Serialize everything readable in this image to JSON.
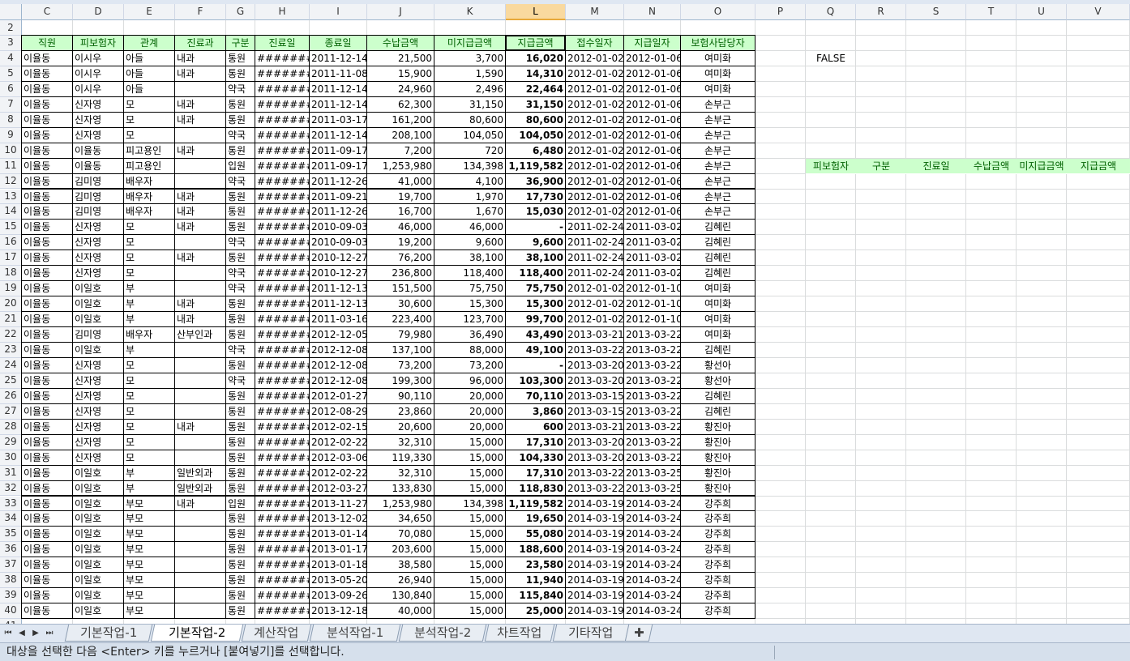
{
  "columns": [
    "C",
    "D",
    "E",
    "F",
    "G",
    "H",
    "I",
    "J",
    "K",
    "L",
    "M",
    "N",
    "O",
    "P",
    "Q",
    "R",
    "S",
    "T",
    "U",
    "V"
  ],
  "selected_column": "L",
  "row_numbers": [
    "2",
    "3",
    "4",
    "5",
    "6",
    "7",
    "8",
    "9",
    "10",
    "11",
    "12",
    "13",
    "14",
    "15",
    "16",
    "17",
    "18",
    "19",
    "20",
    "21",
    "22",
    "23",
    "24",
    "25",
    "26",
    "27",
    "28",
    "29",
    "30",
    "31",
    "32",
    "33",
    "34",
    "35",
    "36",
    "37",
    "38",
    "39",
    "40",
    "41"
  ],
  "table_headers": [
    "직원",
    "피보험자",
    "관계",
    "진료과",
    "구분",
    "진료일",
    "종료일",
    "수납금액",
    "미지급금액",
    "지급금액",
    "접수일자",
    "지급일자",
    "보험사담당자"
  ],
  "rows": [
    [
      "이율동",
      "이시우",
      "아들",
      "내과",
      "통원",
      "########",
      "2011-12-14",
      "21,500",
      "3,700",
      "16,020",
      "2012-01-02",
      "2012-01-06",
      "여미화"
    ],
    [
      "이율동",
      "이시우",
      "아들",
      "내과",
      "통원",
      "########",
      "2011-11-08",
      "15,900",
      "1,590",
      "14,310",
      "2012-01-02",
      "2012-01-06",
      "여미화"
    ],
    [
      "이율동",
      "이시우",
      "아들",
      "",
      "약국",
      "########",
      "2011-12-14",
      "24,960",
      "2,496",
      "22,464",
      "2012-01-02",
      "2012-01-06",
      "여미화"
    ],
    [
      "이율동",
      "신자영",
      "모",
      "내과",
      "통원",
      "########",
      "2011-12-14",
      "62,300",
      "31,150",
      "31,150",
      "2012-01-02",
      "2012-01-06",
      "손부근"
    ],
    [
      "이율동",
      "신자영",
      "모",
      "내과",
      "통원",
      "########",
      "2011-03-17",
      "161,200",
      "80,600",
      "80,600",
      "2012-01-02",
      "2012-01-06",
      "손부근"
    ],
    [
      "이율동",
      "신자영",
      "모",
      "",
      "약국",
      "########",
      "2011-12-14",
      "208,100",
      "104,050",
      "104,050",
      "2012-01-02",
      "2012-01-06",
      "손부근"
    ],
    [
      "이율동",
      "이율동",
      "피고용인",
      "내과",
      "통원",
      "########",
      "2011-09-17",
      "7,200",
      "720",
      "6,480",
      "2012-01-02",
      "2012-01-06",
      "손부근"
    ],
    [
      "이율동",
      "이율동",
      "피고용인",
      "",
      "입원",
      "########",
      "2011-09-17",
      "1,253,980",
      "134,398",
      "1,119,582",
      "2012-01-02",
      "2012-01-06",
      "손부근"
    ],
    [
      "이율동",
      "김미영",
      "배우자",
      "",
      "약국",
      "########",
      "2011-12-26",
      "41,000",
      "4,100",
      "36,900",
      "2012-01-02",
      "2012-01-06",
      "손부근"
    ],
    [
      "이율동",
      "김미영",
      "배우자",
      "내과",
      "통원",
      "########",
      "2011-09-21",
      "19,700",
      "1,970",
      "17,730",
      "2012-01-02",
      "2012-01-06",
      "손부근"
    ],
    [
      "이율동",
      "김미영",
      "배우자",
      "내과",
      "통원",
      "########",
      "2011-12-26",
      "16,700",
      "1,670",
      "15,030",
      "2012-01-02",
      "2012-01-06",
      "손부근"
    ],
    [
      "이율동",
      "신자영",
      "모",
      "내과",
      "통원",
      "########",
      "2010-09-03",
      "46,000",
      "46,000",
      "-",
      "2011-02-24",
      "2011-03-02",
      "김혜린"
    ],
    [
      "이율동",
      "신자영",
      "모",
      "",
      "약국",
      "########",
      "2010-09-03",
      "19,200",
      "9,600",
      "9,600",
      "2011-02-24",
      "2011-03-02",
      "김혜린"
    ],
    [
      "이율동",
      "신자영",
      "모",
      "내과",
      "통원",
      "########",
      "2010-12-27",
      "76,200",
      "38,100",
      "38,100",
      "2011-02-24",
      "2011-03-02",
      "김혜린"
    ],
    [
      "이율동",
      "신자영",
      "모",
      "",
      "약국",
      "########",
      "2010-12-27",
      "236,800",
      "118,400",
      "118,400",
      "2011-02-24",
      "2011-03-02",
      "김혜린"
    ],
    [
      "이율동",
      "이일호",
      "부",
      "",
      "약국",
      "########",
      "2011-12-13",
      "151,500",
      "75,750",
      "75,750",
      "2012-01-02",
      "2012-01-10",
      "여미화"
    ],
    [
      "이율동",
      "이일호",
      "부",
      "내과",
      "통원",
      "########",
      "2011-12-13",
      "30,600",
      "15,300",
      "15,300",
      "2012-01-02",
      "2012-01-10",
      "여미화"
    ],
    [
      "이율동",
      "이일호",
      "부",
      "내과",
      "통원",
      "########",
      "2011-03-16",
      "223,400",
      "123,700",
      "99,700",
      "2012-01-02",
      "2012-01-10",
      "여미화"
    ],
    [
      "이율동",
      "김미영",
      "배우자",
      "산부인과",
      "통원",
      "########",
      "2012-12-05",
      "79,980",
      "36,490",
      "43,490",
      "2013-03-21",
      "2013-03-22",
      "여미화"
    ],
    [
      "이율동",
      "이일호",
      "부",
      "",
      "약국",
      "########",
      "2012-12-08",
      "137,100",
      "88,000",
      "49,100",
      "2013-03-22",
      "2013-03-22",
      "김혜린"
    ],
    [
      "이율동",
      "신자영",
      "모",
      "",
      "통원",
      "########",
      "2012-12-08",
      "73,200",
      "73,200",
      "-",
      "2013-03-20",
      "2013-03-22",
      "황선아"
    ],
    [
      "이율동",
      "신자영",
      "모",
      "",
      "약국",
      "########",
      "2012-12-08",
      "199,300",
      "96,000",
      "103,300",
      "2013-03-20",
      "2013-03-22",
      "황선아"
    ],
    [
      "이율동",
      "신자영",
      "모",
      "",
      "통원",
      "########",
      "2012-01-27",
      "90,110",
      "20,000",
      "70,110",
      "2013-03-15",
      "2013-03-22",
      "김혜린"
    ],
    [
      "이율동",
      "신자영",
      "모",
      "",
      "통원",
      "########",
      "2012-08-29",
      "23,860",
      "20,000",
      "3,860",
      "2013-03-15",
      "2013-03-22",
      "김혜린"
    ],
    [
      "이율동",
      "신자영",
      "모",
      "내과",
      "통원",
      "########",
      "2012-02-15",
      "20,600",
      "20,000",
      "600",
      "2013-03-21",
      "2013-03-22",
      "황진아"
    ],
    [
      "이율동",
      "신자영",
      "모",
      "",
      "통원",
      "########",
      "2012-02-22",
      "32,310",
      "15,000",
      "17,310",
      "2013-03-20",
      "2013-03-22",
      "황진아"
    ],
    [
      "이율동",
      "신자영",
      "모",
      "",
      "통원",
      "########",
      "2012-03-06",
      "119,330",
      "15,000",
      "104,330",
      "2013-03-20",
      "2013-03-22",
      "황진아"
    ],
    [
      "이율동",
      "이일호",
      "부",
      "일반외과",
      "통원",
      "########",
      "2012-02-22",
      "32,310",
      "15,000",
      "17,310",
      "2013-03-22",
      "2013-03-25",
      "황진아"
    ],
    [
      "이율동",
      "이일호",
      "부",
      "일반외과",
      "통원",
      "########",
      "2012-03-27",
      "133,830",
      "15,000",
      "118,830",
      "2013-03-22",
      "2013-03-25",
      "황진아"
    ],
    [
      "이율동",
      "이일호",
      "부모",
      "내과",
      "입원",
      "########",
      "2013-11-27",
      "1,253,980",
      "134,398",
      "1,119,582",
      "2014-03-19",
      "2014-03-24",
      "강주희"
    ],
    [
      "이율동",
      "이일호",
      "부모",
      "",
      "통원",
      "########",
      "2013-12-02",
      "34,650",
      "15,000",
      "19,650",
      "2014-03-19",
      "2014-03-24",
      "강주희"
    ],
    [
      "이율동",
      "이일호",
      "부모",
      "",
      "통원",
      "########",
      "2013-01-14",
      "70,080",
      "15,000",
      "55,080",
      "2014-03-19",
      "2014-03-24",
      "강주희"
    ],
    [
      "이율동",
      "이일호",
      "부모",
      "",
      "통원",
      "########",
      "2013-01-17",
      "203,600",
      "15,000",
      "188,600",
      "2014-03-19",
      "2014-03-24",
      "강주희"
    ],
    [
      "이율동",
      "이일호",
      "부모",
      "",
      "통원",
      "########",
      "2013-01-18",
      "38,580",
      "15,000",
      "23,580",
      "2014-03-19",
      "2014-03-24",
      "강주희"
    ],
    [
      "이율동",
      "이일호",
      "부모",
      "",
      "통원",
      "########",
      "2013-05-20",
      "26,940",
      "15,000",
      "11,940",
      "2014-03-19",
      "2014-03-24",
      "강주희"
    ],
    [
      "이율동",
      "이일호",
      "부모",
      "",
      "통원",
      "########",
      "2013-09-26",
      "130,840",
      "15,000",
      "115,840",
      "2014-03-19",
      "2014-03-24",
      "강주희"
    ],
    [
      "이율동",
      "이일호",
      "부모",
      "",
      "통원",
      "########",
      "2013-12-18",
      "40,000",
      "15,000",
      "25,000",
      "2014-03-19",
      "2014-03-24",
      "강주희"
    ]
  ],
  "false_cell": "FALSE",
  "criteria_headers": [
    "피보험자",
    "구분",
    "진료일",
    "수납금액",
    "미지급금액",
    "지급금액"
  ],
  "sheet_tabs": [
    "기본작업-1",
    "기본작업-2",
    "계산작업",
    "분석작업-1",
    "분석작업-2",
    "차트작업",
    "기타작업"
  ],
  "active_tab": "기본작업-2",
  "status_text": "대상을 선택한 다음 <Enter> 키를 누르거나 [붙여넣기]를 선택합니다.",
  "colors": {
    "header_fill": "#ccffcc",
    "header_text": "#006100",
    "selected_col": "#f9d99f"
  }
}
